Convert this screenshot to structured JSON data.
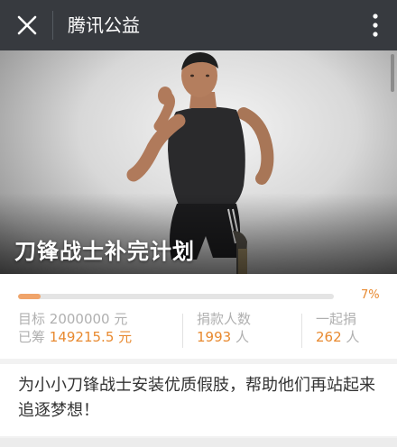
{
  "header": {
    "title": "腾讯公益",
    "close_icon": "close-icon",
    "more_icon": "more-vertical-icon"
  },
  "hero": {
    "caption": "刀锋战士补完计划",
    "image": "man-in-sprint-pose-with-prosthetic-leg"
  },
  "progress": {
    "percent_label": "7%",
    "fraction": 0.07
  },
  "stats": {
    "target_label": "目标",
    "target_value": "2000000",
    "target_unit": "元",
    "raised_label": "已筹",
    "raised_value": "149215.5",
    "raised_unit": "元",
    "donors_label": "捐款人数",
    "donors_value": "1993",
    "donors_unit": "人",
    "together_label": "一起捐",
    "together_value": "262",
    "together_unit": "人"
  },
  "description": "为小小刀锋战士安装优质假肢，帮助他们再站起来追逐梦想！",
  "colors": {
    "topbar": "#373a3f",
    "accent": "#e8892f",
    "progress_fill": "#f0a46a"
  }
}
